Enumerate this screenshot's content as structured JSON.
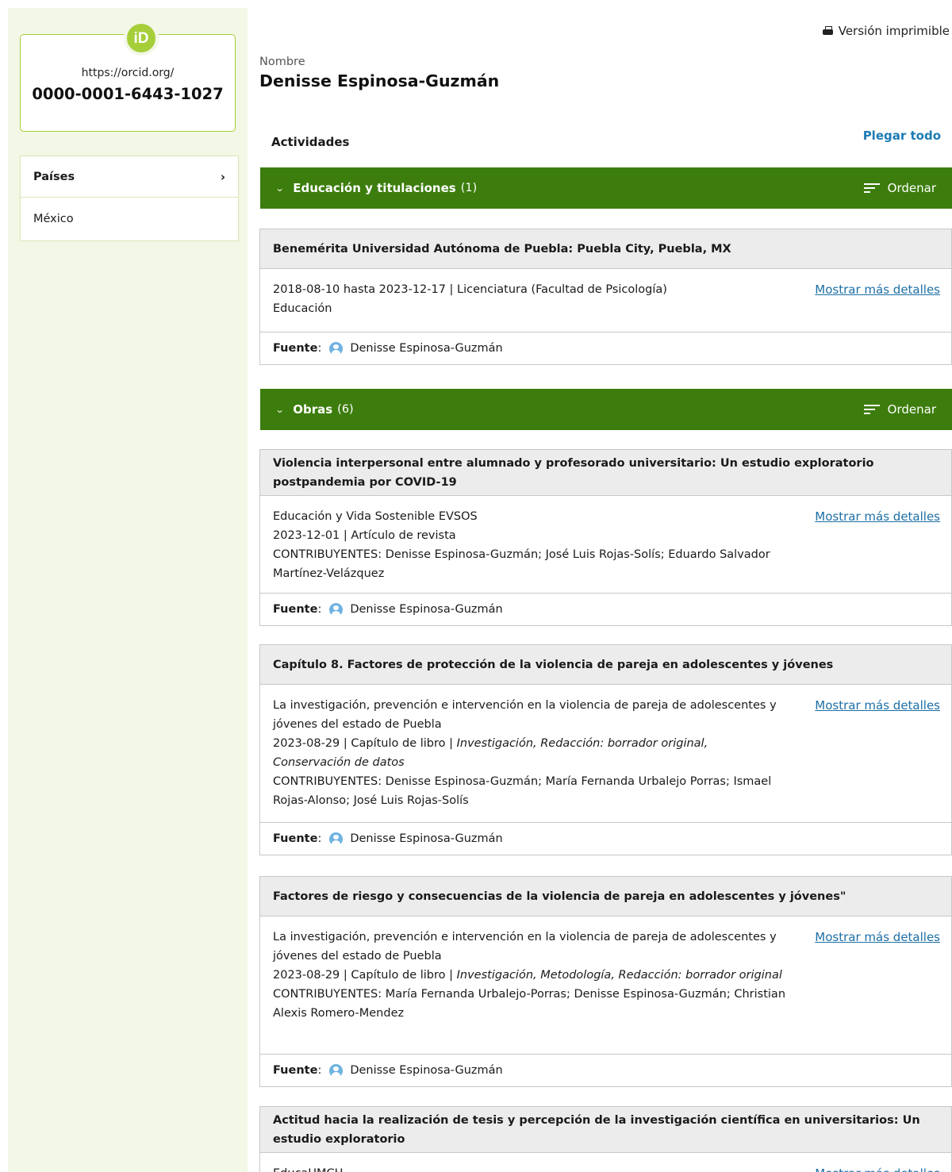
{
  "orcid": {
    "logo_text": "iD",
    "url": "https://orcid.org/",
    "number": "0000-0001-6443-1027"
  },
  "countries": {
    "heading": "Países",
    "items": [
      "México"
    ]
  },
  "print_label": "Versión imprimible",
  "name": {
    "label": "Nombre",
    "value": "Denisse Espinosa-Guzmán"
  },
  "activities": {
    "heading": "Actividades",
    "fold_all": "Plegar todo"
  },
  "sections": {
    "education": {
      "title": "Educación y titulaciones",
      "count": "(1)",
      "sort_label": "Ordenar"
    },
    "works": {
      "title": "Obras",
      "count": "(6)",
      "sort_label": "Ordenar"
    }
  },
  "source_label": "Fuente",
  "more_details": "Mostrar más detalles",
  "education_items": [
    {
      "title": "Benemérita Universidad Autónoma de Puebla: Puebla City, Puebla, MX",
      "line1": "2018-08-10 hasta 2023-12-17 | Licenciatura (Facultad de Psicología)",
      "line2": "Educación",
      "source": "Denisse Espinosa-Guzmán"
    }
  ],
  "works": [
    {
      "title": "Violencia interpersonal entre alumnado y profesorado universitario: Un estudio exploratorio postpandemia por COVID-19",
      "journal": "Educación y Vida Sostenible EVSOS",
      "meta": "2023-12-01 | Artículo de revista",
      "contributors": "CONTRIBUYENTES: Denisse Espinosa-Guzmán; José Luis Rojas-Solís; Eduardo Salvador Martínez-Velázquez",
      "source": "Denisse Espinosa-Guzmán"
    },
    {
      "title": "Capítulo 8. Factores de protección de la violencia de pareja en adolescentes y jóvenes",
      "journal": "La investigación, prevención e intervención en la violencia de pareja de adolescentes y jóvenes del estado de Puebla",
      "meta": "2023-08-29 | Capítulo de libro | ",
      "roles": "Investigación, Redacción: borrador original, Conservación de datos",
      "contributors": "CONTRIBUYENTES: Denisse Espinosa-Guzmán; María Fernanda Urbalejo Porras; Ismael Rojas-Alonso; José Luis Rojas-Solís",
      "source": "Denisse Espinosa-Guzmán"
    },
    {
      "title": "Factores de riesgo y consecuencias de la violencia de pareja en adolescentes y jóvenes\"",
      "journal": "La investigación, prevención e intervención en la violencia de pareja de adolescentes y jóvenes del estado de Puebla",
      "meta": "2023-08-29 | Capítulo de libro | ",
      "roles": "Investigación, Metodología, Redacción: borrador original",
      "contributors": "CONTRIBUYENTES: María Fernanda Urbalejo-Porras; Denisse Espinosa-Guzmán; Christian Alexis Romero-Mendez",
      "source": "Denisse Espinosa-Guzmán"
    },
    {
      "title": "Actitud hacia la realización de tesis y percepción de la investigación científica en universitarios: Un estudio exploratorio",
      "journal": "EducaUMCH"
    }
  ]
}
